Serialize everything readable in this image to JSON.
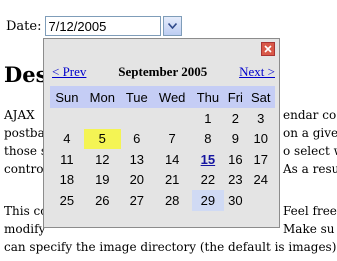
{
  "field": {
    "label": "Date:",
    "value": "7/12/2005"
  },
  "page": {
    "heading": "Desc",
    "para1": [
      "AJAX",
      "postbac",
      "those s",
      "contro"
    ],
    "para1_right": [
      "endar co",
      "on a give",
      "o select w",
      "As a resu"
    ],
    "para2_lines": [
      "This co",
      "modify",
      "can specify the image directory (the default is images)."
    ],
    "para2_right": [
      "Feel free",
      "Make su"
    ]
  },
  "calendar": {
    "prev_label": "< Prev",
    "next_label": "Next >",
    "month_title": "September 2005",
    "weekdays": [
      "Sun",
      "Mon",
      "Tue",
      "Wed",
      "Thu",
      "Fri",
      "Sat"
    ],
    "weeks": [
      [
        "",
        "",
        "",
        "",
        "1",
        "2",
        "3"
      ],
      [
        "4",
        "5",
        "6",
        "7",
        "8",
        "9",
        "10"
      ],
      [
        "11",
        "12",
        "13",
        "14",
        "15",
        "16",
        "17"
      ],
      [
        "18",
        "19",
        "20",
        "21",
        "22",
        "23",
        "24"
      ],
      [
        "25",
        "26",
        "27",
        "28",
        "29",
        "30",
        ""
      ]
    ],
    "today": "5",
    "selected": "15",
    "hovered": "29"
  }
}
